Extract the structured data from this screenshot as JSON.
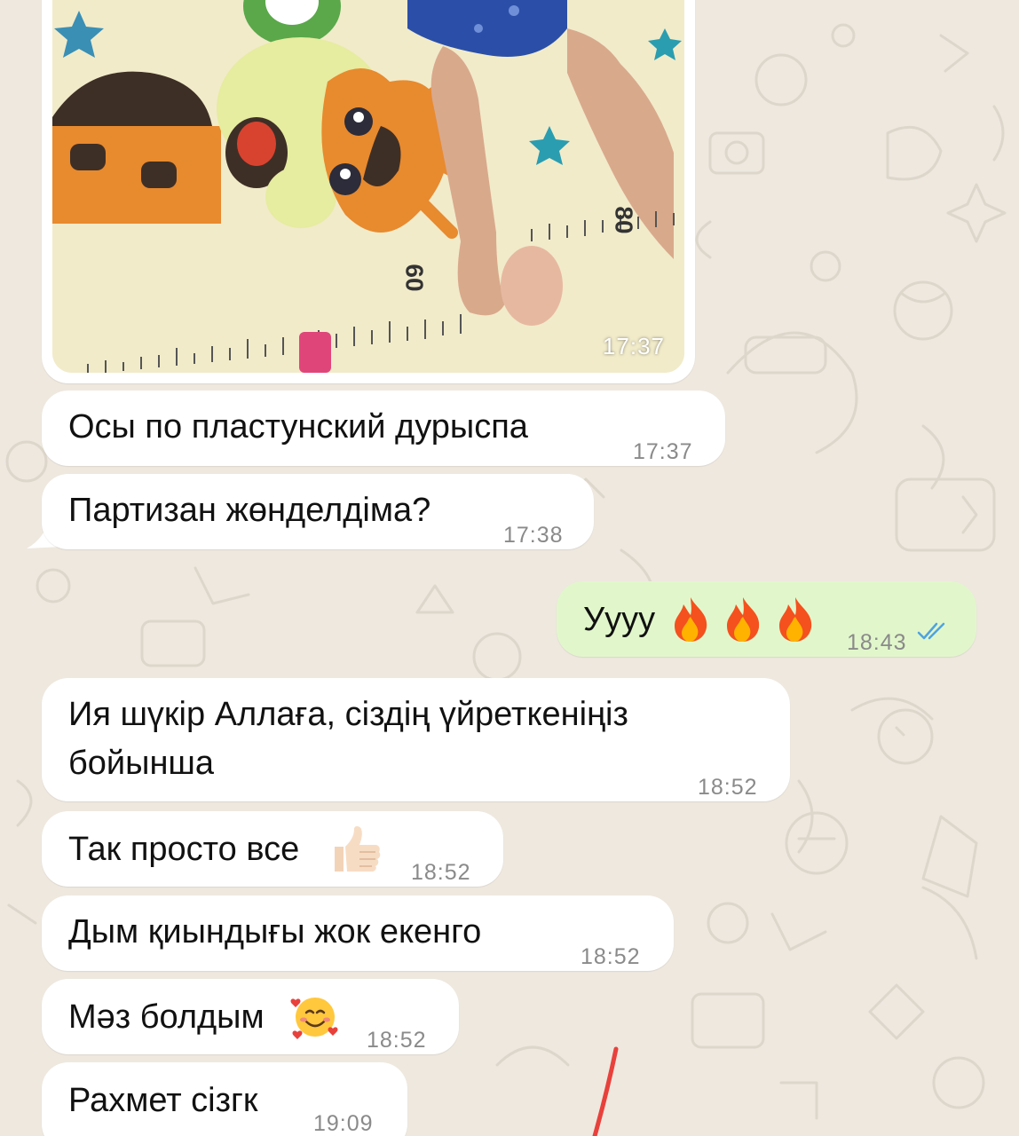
{
  "photo_message": {
    "time": "17:37",
    "ruler_labels": [
      "60",
      "80"
    ]
  },
  "messages": [
    {
      "id": "m1",
      "direction": "incoming",
      "text": "Осы по пластунский дурыспа",
      "time": "17:37"
    },
    {
      "id": "m2",
      "direction": "incoming",
      "text": "Партизан жөнделдіма?",
      "time": "17:38"
    },
    {
      "id": "m3",
      "direction": "outgoing",
      "text": "Уууу",
      "emoji": "fire-icon ×3",
      "time": "18:43",
      "status": "read"
    },
    {
      "id": "m4",
      "direction": "incoming",
      "text_line1": "Ия шүкір Аллаға, сіздің үйреткеніңіз",
      "text_line2": "бойынша",
      "time": "18:52"
    },
    {
      "id": "m5",
      "direction": "incoming",
      "text": "Так просто все",
      "emoji": "thumbs-up-icon",
      "time": "18:52"
    },
    {
      "id": "m6",
      "direction": "incoming",
      "text": "Дым қиындығы жок екенго",
      "time": "18:52"
    },
    {
      "id": "m7",
      "direction": "incoming",
      "text": "Мәз болдым",
      "emoji": "smiling-face-with-hearts-icon",
      "time": "18:52"
    },
    {
      "id": "m8",
      "direction": "incoming",
      "text": "Рахмет сізгк",
      "time": "19:09"
    }
  ],
  "colors": {
    "background": "#eee8df",
    "incoming_bubble": "#ffffff",
    "outgoing_bubble": "#e1f7cb",
    "timestamp": "#8a8a8a",
    "read_ticks": "#4fa3e0",
    "annotation_mark": "#e8413c"
  }
}
